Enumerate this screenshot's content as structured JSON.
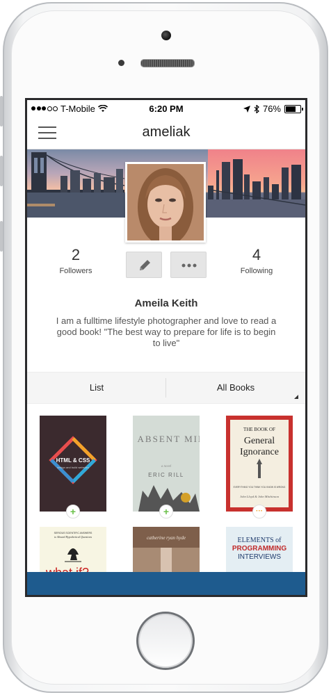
{
  "status_bar": {
    "carrier": "T-Mobile",
    "time": "6:20 PM",
    "battery": "76%",
    "battery_level": 0.76
  },
  "navbar": {
    "title": "ameliak"
  },
  "profile": {
    "followers_count": "2",
    "followers_label": "Followers",
    "following_count": "4",
    "following_label": "Following",
    "name": "Ameila Keith",
    "bio": "I am a fulltime lifestyle photographer and love to read a good book! \"The best way to prepare for life is to begin to live\""
  },
  "tabs": {
    "list_label": "List",
    "filter_label": "All Books"
  },
  "books": [
    {
      "title": "HTML & CSS",
      "subtitle": "design and build websites",
      "badge": "+",
      "badge_color": "#6cc04a",
      "cover_color": "#3b2a2e"
    },
    {
      "title": "AN ABSENT MIND",
      "subtitle": "a novel",
      "author": "ERIC RILL",
      "badge": "+",
      "badge_color": "#6cc04a",
      "cover_color": "#cfd8d2"
    },
    {
      "title": "THE BOOK OF",
      "title2": "General",
      "title3": "Ignorance",
      "tagline": "EVERYTHING YOU THINK YOU KNOW IS WRONG",
      "author": "John Lloyd & John Mitchinson",
      "badge": "···",
      "badge_color": "#f0a020",
      "cover_color": "#c8312e"
    },
    {
      "title": "what if?",
      "tagline1": "SERIOUS SCIENTIFIC ANSWERS",
      "tagline2": "to Absurd Hypothetical Questions",
      "cover_color": "#f7f5e3"
    },
    {
      "title": "catherine ryan hyde",
      "cover_color": "#a88b74"
    },
    {
      "title": "ELEMENTS of",
      "title2": "PROGRAMMING",
      "title3": "INTERVIEWS",
      "cover_color": "#e4eef3"
    }
  ],
  "colors": {
    "accent_bottom_bar": "#1e5b8e",
    "add_green": "#6cc04a",
    "more_orange": "#f0a020"
  }
}
